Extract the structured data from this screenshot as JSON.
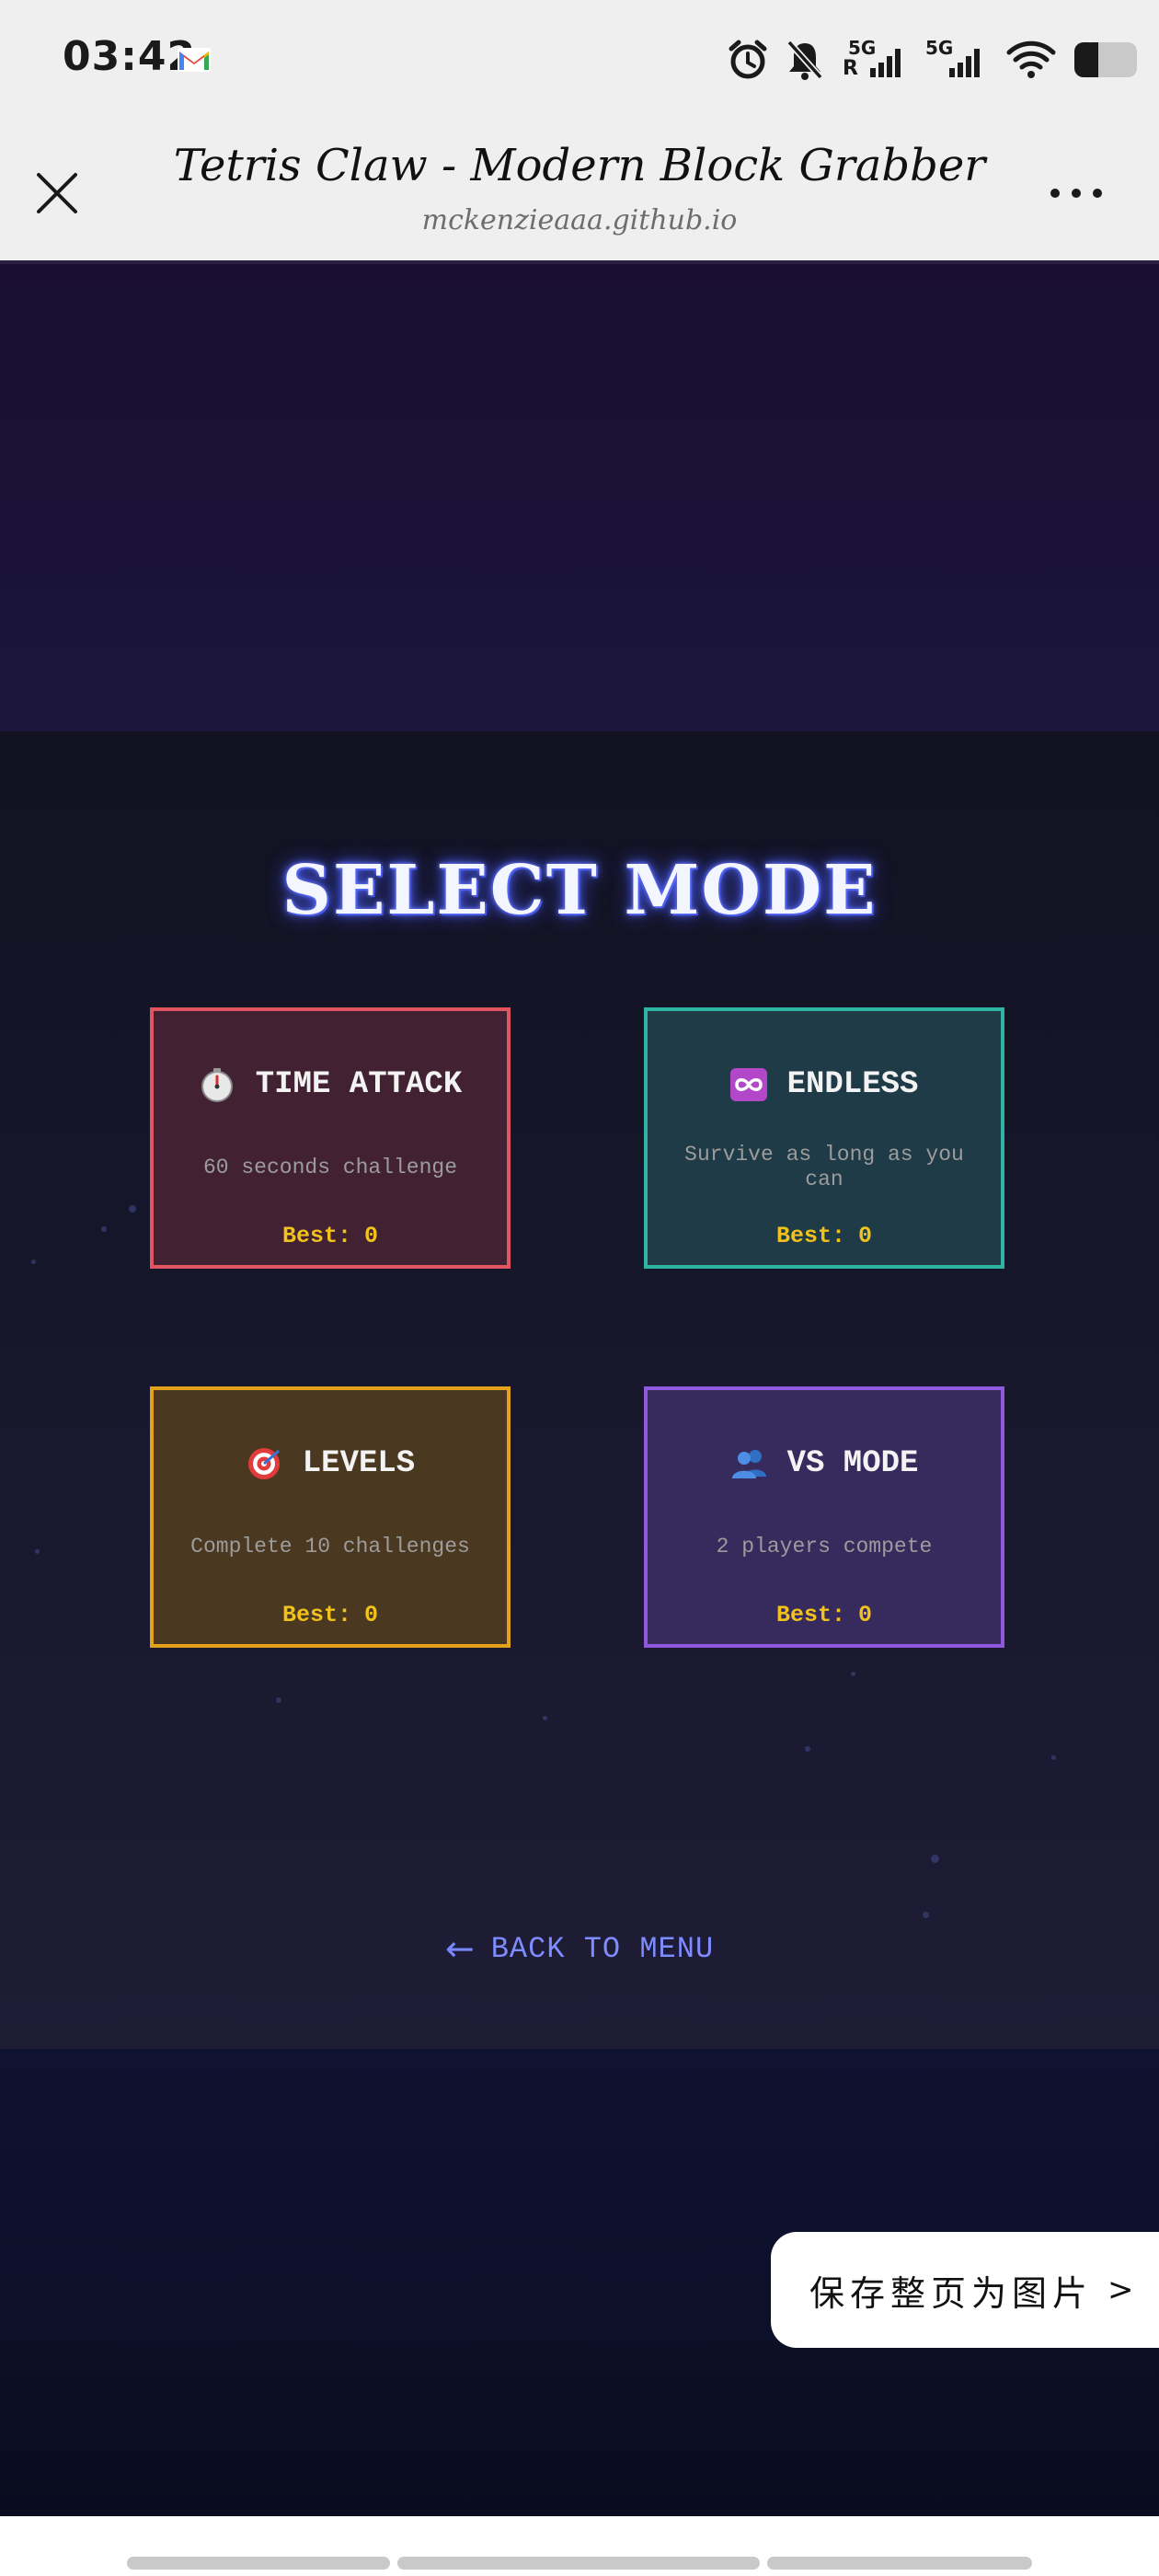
{
  "status_bar": {
    "time": "03:42",
    "icons": [
      "gmail-icon",
      "alarm-icon",
      "bell-off-icon",
      "signal-icon",
      "signal-icon",
      "wifi-icon",
      "battery-icon"
    ],
    "network_1_label": "5G",
    "network_1_sub": "R",
    "network_2_label": "5G"
  },
  "browser": {
    "title": "Tetris Claw - Modern Block Grabber",
    "url": "mckenzieaaa.github.io",
    "close_icon": "close-icon",
    "more_icon": "more-icon"
  },
  "game": {
    "heading": "SELECT MODE",
    "best_label": "Best:",
    "modes": [
      {
        "name": "TIME ATTACK",
        "icon": "stopwatch-icon",
        "description": "60 seconds challenge",
        "best": "0",
        "border_color": "#e0555f"
      },
      {
        "name": "ENDLESS",
        "icon": "infinity-icon",
        "description": "Survive as long as you can",
        "best": "0",
        "border_color": "#2fb3a2"
      },
      {
        "name": "LEVELS",
        "icon": "target-icon",
        "description": "Complete 10 challenges",
        "best": "0",
        "border_color": "#e3a21c"
      },
      {
        "name": "VS MODE",
        "icon": "players-icon",
        "description": "2 players compete",
        "best": "0",
        "border_color": "#9059dd"
      }
    ],
    "back_button": {
      "arrow": "←",
      "label": "BACK TO MENU"
    }
  },
  "overlay": {
    "save_page_label": "保存整页为图片",
    "save_page_chevron": ">"
  },
  "colors": {
    "accent_blue": "#7d8cff",
    "best_yellow": "#f1c21b"
  }
}
